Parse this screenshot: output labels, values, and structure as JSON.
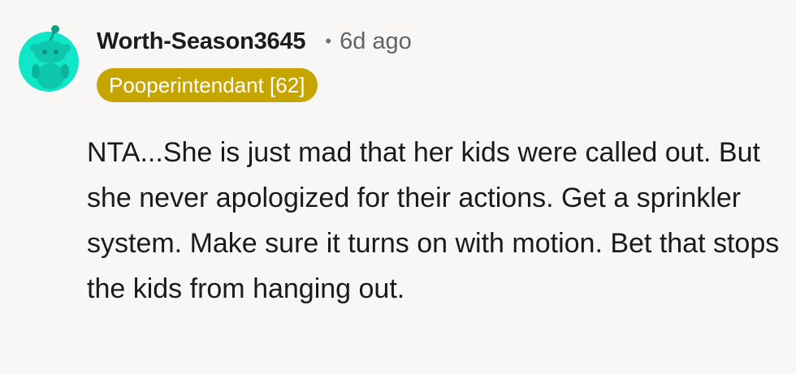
{
  "comment": {
    "author": "Worth-Season3645",
    "separator": "•",
    "timestamp": "6d ago",
    "flair": "Pooperintendant [62]",
    "body": "NTA...She is just mad that her kids were called out. But she never apologized for their actions. Get a sprinkler system. Make sure it turns on with motion. Bet that stops the kids from hanging out.",
    "avatar_icon": "reddit-snoo-avatar-icon"
  },
  "colors": {
    "background": "#f8f7f6",
    "avatar_bg": "#10e6c8",
    "flair_bg": "#c7a500",
    "flair_text": "#ffffff",
    "meta_text": "#5f6469"
  }
}
